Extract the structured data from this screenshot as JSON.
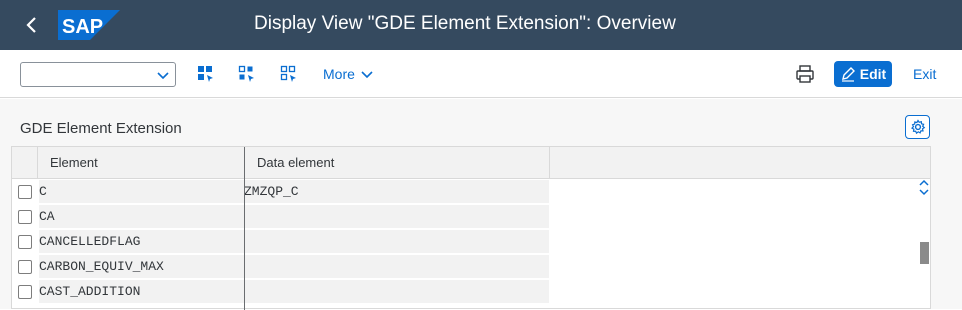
{
  "header": {
    "title": "Display View \"GDE Element Extension\": Overview",
    "logo_text": "SAP"
  },
  "toolbar": {
    "dropdown_value": "",
    "more_label": "More",
    "edit_label": "Edit",
    "exit_label": "Exit"
  },
  "section": {
    "title": "GDE Element Extension"
  },
  "table": {
    "columns": [
      "Element",
      "Data element"
    ],
    "rows": [
      {
        "element": "C",
        "data_element": "ZMZQP_C"
      },
      {
        "element": "CA",
        "data_element": ""
      },
      {
        "element": "CANCELLEDFLAG",
        "data_element": ""
      },
      {
        "element": "CARBON_EQUIV_MAX",
        "data_element": ""
      },
      {
        "element": "CAST_ADDITION",
        "data_element": ""
      }
    ]
  },
  "colors": {
    "shell": "#354a5f",
    "accent": "#0a6ed1"
  }
}
